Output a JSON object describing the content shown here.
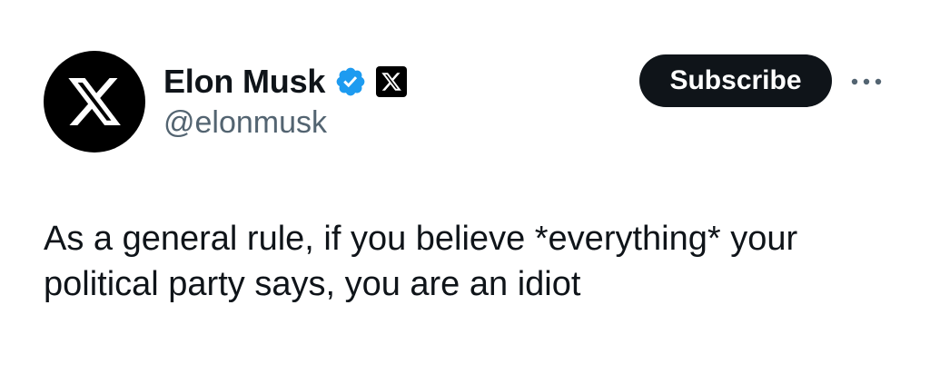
{
  "tweet": {
    "author": {
      "display_name": "Elon Musk",
      "handle": "@elonmusk",
      "avatar_icon": "x-logo-icon",
      "verified_icon": "verified-badge-icon",
      "affiliate_icon": "x-affiliate-icon"
    },
    "actions": {
      "subscribe_label": "Subscribe",
      "more_icon": "more-options-icon"
    },
    "text": "As a general rule, if you believe *everything* your political party says, you are an idiot"
  },
  "colors": {
    "primary_text": "#0f1419",
    "secondary_text": "#536471",
    "verified_blue": "#1d9bf0",
    "button_bg": "#0f1419",
    "background": "#ffffff"
  }
}
